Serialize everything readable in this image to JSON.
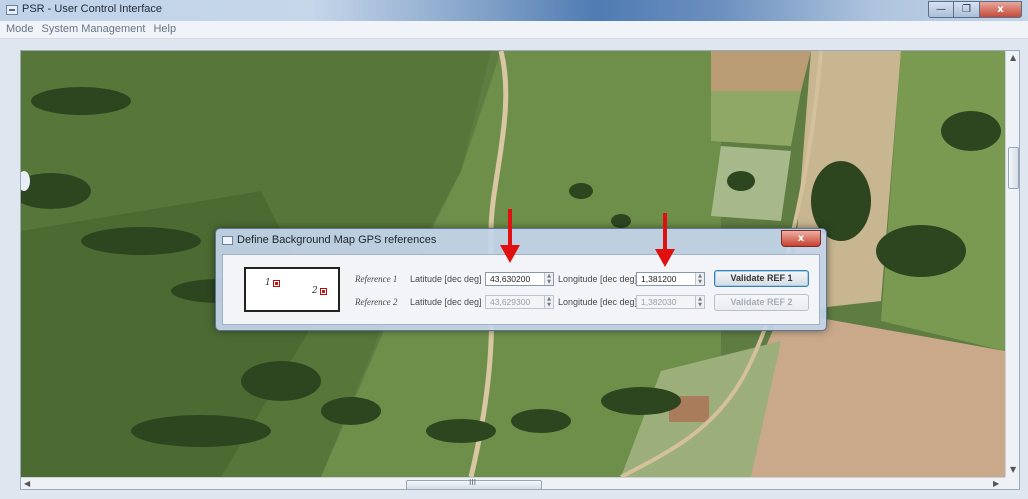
{
  "window": {
    "title": "PSR - User Control Interface",
    "controls": {
      "minimize": "—",
      "maximize": "❐",
      "close": "x"
    }
  },
  "menu": {
    "items": [
      "Mode",
      "System Management",
      "Help"
    ]
  },
  "map": {
    "description_icon": "satellite-map"
  },
  "dialog": {
    "title": "Define Background Map GPS references",
    "close": "x",
    "preview": {
      "point1": "1",
      "point2": "2"
    },
    "ref1": {
      "label": "Reference 1",
      "lat_label": "Latitude [dec deg]",
      "lat_value": "43,630200",
      "lon_label": "Longitude [dec deg]",
      "lon_value": "1,381200",
      "button": "Validate REF 1"
    },
    "ref2": {
      "label": "Reference 2",
      "lat_label": "Latitude [dec deg]",
      "lat_value": "43,629300",
      "lon_label": "Longitude [dec deg]",
      "lon_value": "1,382030",
      "button": "Validate REF 2"
    }
  },
  "scrollbar": {
    "h_thumb_grip": "III"
  },
  "colors": {
    "arrow": "#e01010",
    "marker": "#d01414",
    "accent": "#3c7fb1"
  }
}
